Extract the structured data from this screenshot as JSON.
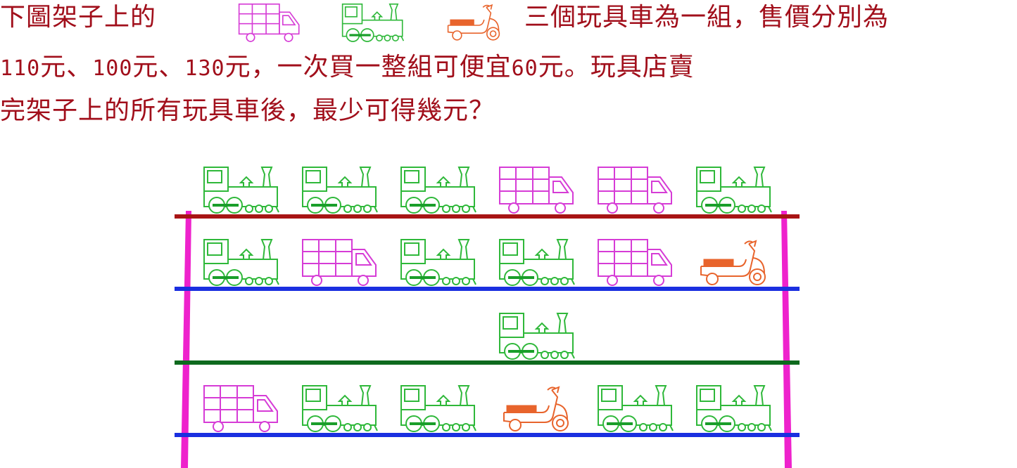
{
  "question": {
    "line1_before": "下圖架子上的",
    "line1_after": "三個玩具車為一組，售價分別為",
    "line2": [
      {
        "t": "110",
        "num": true
      },
      {
        "t": " 元、",
        "num": false
      },
      {
        "t": "100",
        "num": true
      },
      {
        "t": " 元、",
        "num": false
      },
      {
        "t": "130",
        "num": true
      },
      {
        "t": " 元，一次買一整組可便宜 ",
        "num": false
      },
      {
        "t": "60",
        "num": true
      },
      {
        "t": " 元。玩具店賣",
        "num": false
      }
    ],
    "line3": "完架子上的所有玩具車後，最少可得幾元？"
  },
  "legend": [
    "truck",
    "train",
    "scooter"
  ],
  "colors": {
    "text": "#a10f1b",
    "truck": "#d63cd6",
    "train": "#2fb83a",
    "scooter": "#e8642c",
    "axle": "#1a9e2a",
    "post": "#ee22cc",
    "shelf_top": "#a81515",
    "shelf_blue": "#1a2fe0",
    "shelf_green": "#0e6a1e"
  },
  "shelves": [
    {
      "color": "shelf_top",
      "items": [
        "train",
        "train",
        "train",
        "truck",
        "truck",
        "train"
      ]
    },
    {
      "color": "shelf_blue",
      "items": [
        "train",
        "truck",
        "train",
        "train",
        "truck",
        "scooter"
      ]
    },
    {
      "color": "shelf_green",
      "items": [
        "",
        "",
        "",
        "train",
        "",
        ""
      ]
    },
    {
      "color": "shelf_blue",
      "items": [
        "truck",
        "train",
        "train",
        "scooter",
        "train",
        "train"
      ]
    }
  ]
}
